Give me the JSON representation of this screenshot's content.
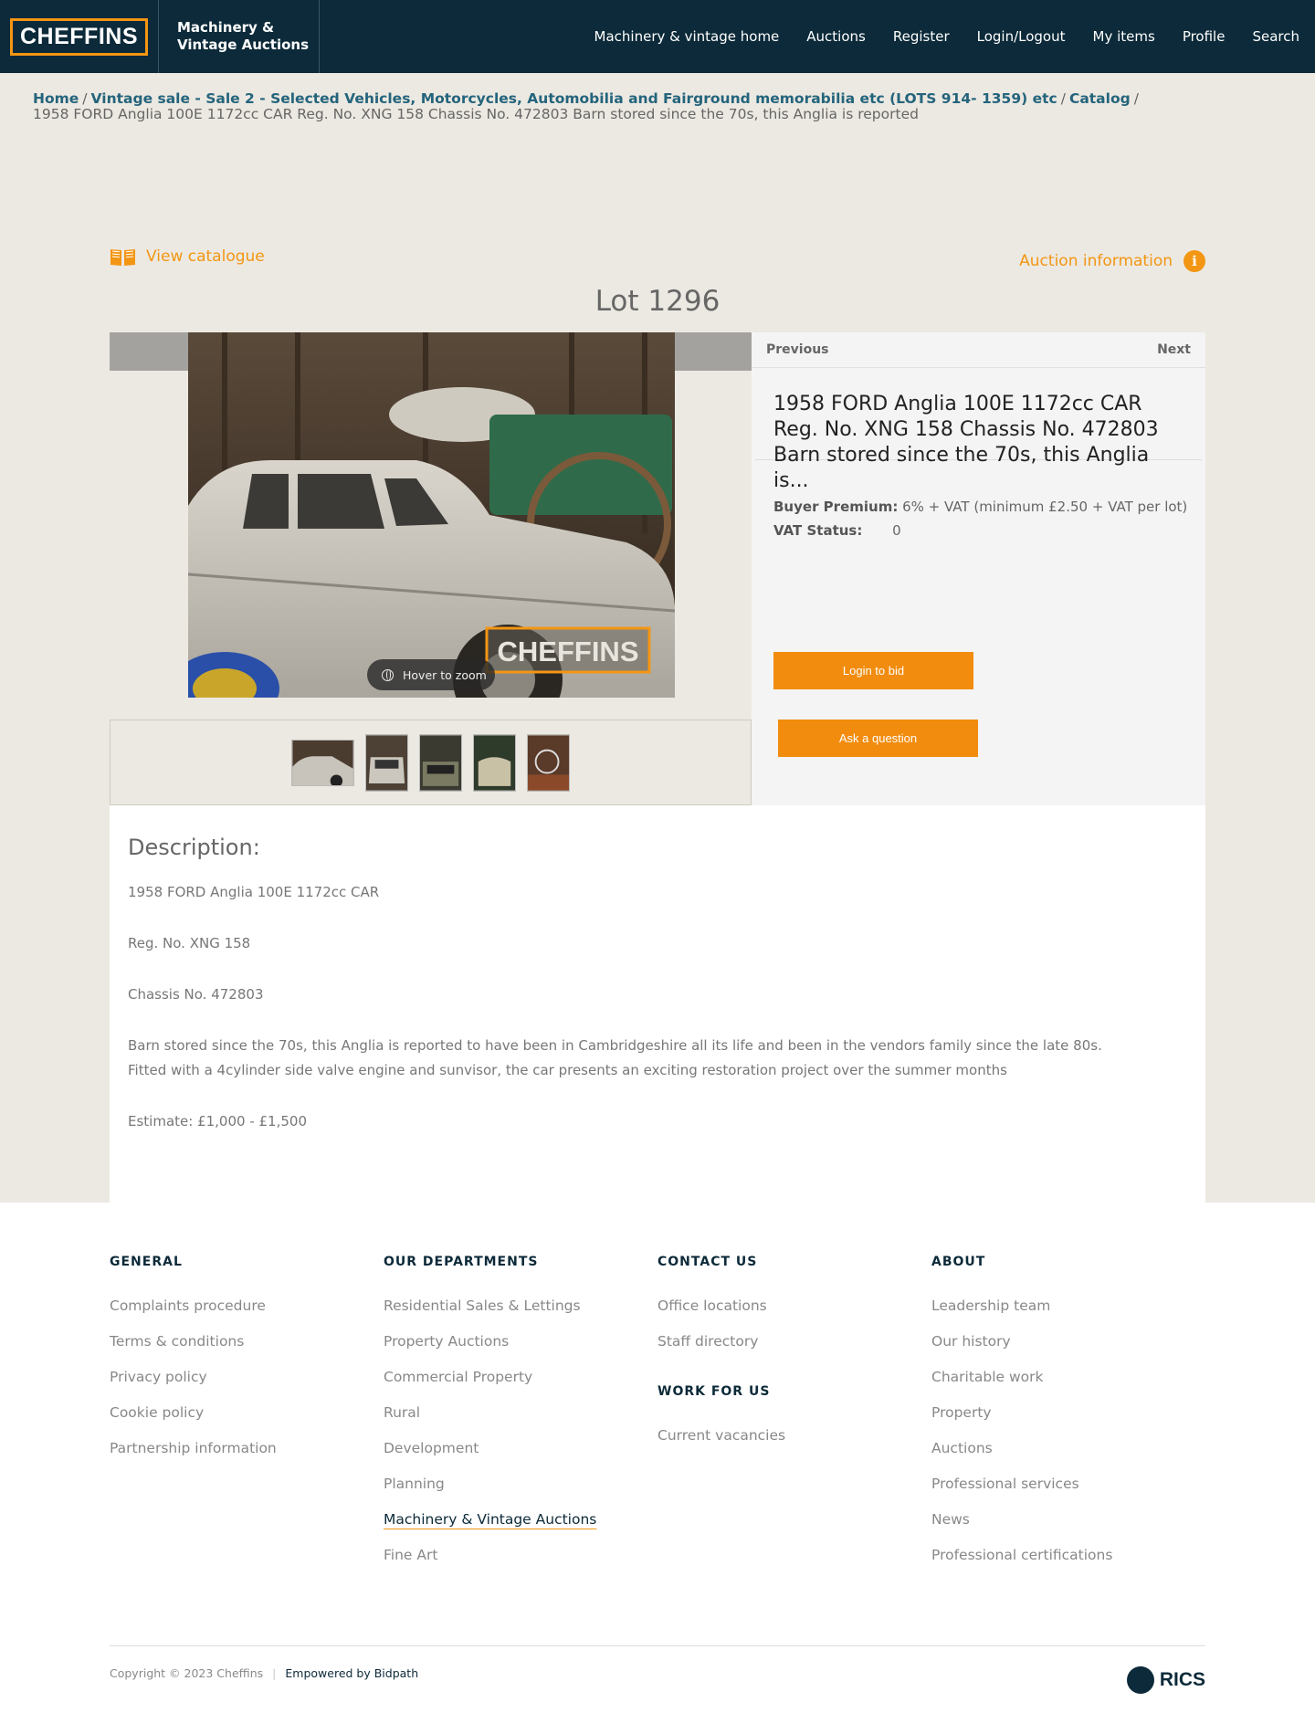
{
  "header": {
    "logo": "CHEFFINS",
    "brand_line1": "Machinery &",
    "brand_line2": "Vintage Auctions",
    "nav": [
      "Machinery & vintage home",
      "Auctions",
      "Register",
      "Login/Logout",
      "My items",
      "Profile",
      "Search"
    ]
  },
  "breadcrumb": {
    "home": "Home",
    "sale": "Vintage sale - Sale 2 - Selected Vehicles, Motorcycles, Automobilia and Fairground memorabilia etc (LOTS 914- 1359) etc",
    "catalog": "Catalog",
    "current": "1958 FORD Anglia 100E 1172cc CAR Reg. No. XNG 158 Chassis No. 472803 Barn stored since the 70s, this Anglia is reported"
  },
  "lot": {
    "view_catalogue": "View catalogue",
    "auction_info": "Auction information",
    "title": "Lot 1296",
    "zoom_hint": "Hover to zoom",
    "watermark": "CHEFFINS",
    "previous": "Previous",
    "next": "Next",
    "name": "1958 FORD Anglia 100E 1172cc CAR Reg. No. XNG 158 Chassis No. 472803 Barn stored since the 70s, this Anglia is...",
    "buyer_premium_label": "Buyer Premium:",
    "buyer_premium_value": "6% + VAT (minimum £2.50 + VAT per lot)",
    "vat_label": "VAT Status:",
    "vat_value": "0",
    "login_to_bid": "Login to bid",
    "ask_question": "Ask a question"
  },
  "description": {
    "heading": "Description:",
    "paragraphs": [
      "1958 FORD Anglia 100E 1172cc CAR",
      "Reg. No. XNG 158",
      "Chassis No. 472803",
      "Barn stored since the 70s, this Anglia is reported to have been in Cambridgeshire all its life and been in the vendors family since the late 80s. Fitted with a 4cylinder side valve engine and sunvisor, the car presents an exciting restoration project over the summer months",
      "Estimate: £1,000 - £1,500"
    ]
  },
  "footer": {
    "general": {
      "heading": "GENERAL",
      "links": [
        "Complaints procedure",
        "Terms & conditions",
        "Privacy policy",
        "Cookie policy",
        "Partnership information"
      ]
    },
    "departments": {
      "heading": "OUR DEPARTMENTS",
      "links": [
        "Residential Sales & Lettings",
        "Property Auctions",
        "Commercial Property",
        "Rural",
        "Development",
        "Planning",
        "Machinery & Vintage Auctions",
        "Fine Art"
      ]
    },
    "contact": {
      "heading": "CONTACT US",
      "links": [
        "Office locations",
        "Staff directory"
      ]
    },
    "work": {
      "heading": "WORK FOR US",
      "links": [
        "Current vacancies"
      ]
    },
    "about": {
      "heading": "ABOUT",
      "links": [
        "Leadership team",
        "Our history",
        "Charitable work",
        "Property",
        "Auctions",
        "Professional services",
        "News",
        "Professional certifications"
      ]
    },
    "copyright": "Copyright © 2023 Cheffins",
    "powered": "Empowered by Bidpath",
    "rics": "RICS"
  },
  "colors": {
    "navy": "#0c2a39",
    "orange": "#f39613",
    "teal_link": "#24647c",
    "page_bg": "#ece9e2"
  }
}
